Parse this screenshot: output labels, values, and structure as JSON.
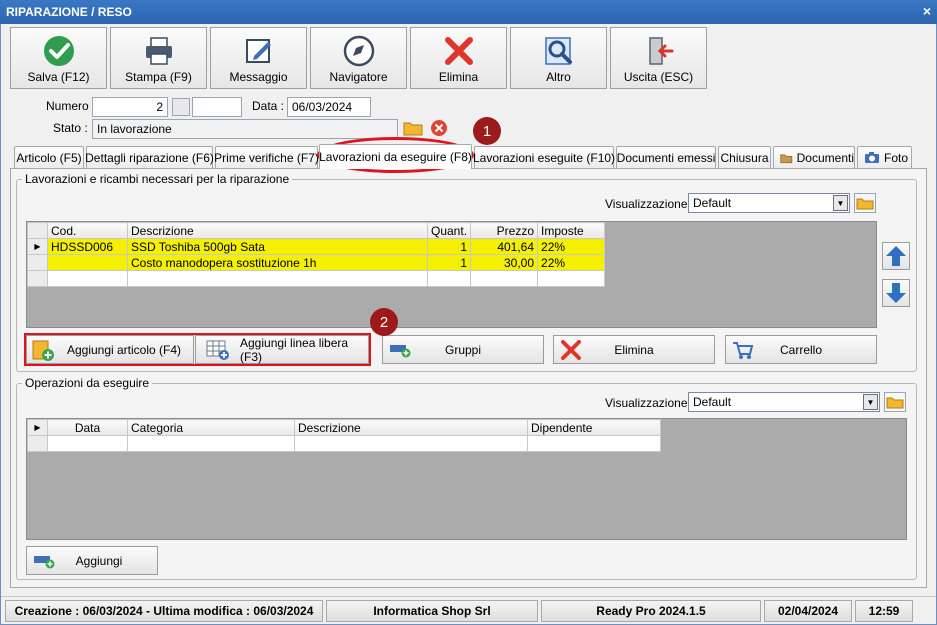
{
  "window": {
    "title": "RIPARAZIONE / RESO",
    "close_glyph": "×"
  },
  "toolbar": [
    {
      "label": "Salva (F12)",
      "icon": "check-circle-icon",
      "color": "#2e9d4e"
    },
    {
      "label": "Stampa (F9)",
      "icon": "printer-icon"
    },
    {
      "label": "Messaggio",
      "icon": "message-edit-icon"
    },
    {
      "label": "Navigatore",
      "icon": "compass-icon"
    },
    {
      "label": "Elimina",
      "icon": "delete-x-icon",
      "color": "#e0352b"
    },
    {
      "label": "Altro",
      "icon": "magnifier-icon"
    },
    {
      "label": "Uscita (ESC)",
      "icon": "exit-door-icon"
    }
  ],
  "form": {
    "numero_label": "Numero :",
    "numero_value": "2",
    "numero_suffix": "",
    "data_label": "Data :",
    "data_value": "06/03/2024",
    "stato_label": "Stato :",
    "stato_value": "In lavorazione"
  },
  "tabs": [
    {
      "label": "Articolo (F5)"
    },
    {
      "label": "Dettagli riparazione (F6)"
    },
    {
      "label": "Prime verifiche (F7)"
    },
    {
      "label": "Lavorazioni da eseguire (F8)",
      "active": true
    },
    {
      "label": "Lavorazioni eseguite (F10)"
    },
    {
      "label": "Documenti emessi"
    },
    {
      "label": "Chiusura"
    },
    {
      "label": "Documenti",
      "icon": "folder-icon"
    },
    {
      "label": "Foto",
      "icon": "camera-icon"
    }
  ],
  "lavorazioni": {
    "group_title": "Lavorazioni e ricambi necessari per la riparazione",
    "view_label": "Visualizzazione :",
    "view_value": "Default",
    "columns": [
      "Cod.",
      "Descrizione",
      "Quant.",
      "Prezzo",
      "Imposte"
    ],
    "rows": [
      {
        "cod": "HDSSD006",
        "descrizione": "SSD Toshiba 500gb Sata",
        "quant": "1",
        "prezzo": "401,64",
        "imposte": "22%"
      },
      {
        "cod": "",
        "descrizione": "Costo manodopera sostituzione 1h",
        "quant": "1",
        "prezzo": "30,00",
        "imposte": "22%"
      }
    ],
    "buttons": {
      "aggiungi_articolo": "Aggiungi articolo (F4)",
      "aggiungi_linea": "Aggiungi linea libera (F3)",
      "gruppi": "Gruppi",
      "elimina": "Elimina",
      "carrello": "Carrello"
    }
  },
  "operazioni": {
    "group_title": "Operazioni da eseguire",
    "view_label": "Visualizzazione :",
    "view_value": "Default",
    "columns": [
      "Data",
      "Categoria",
      "Descrizione",
      "Dipendente"
    ],
    "add_button": "Aggiungi"
  },
  "annotations": {
    "badge1": "1",
    "badge2": "2",
    "highlight_color": "#e0141e"
  },
  "statusbar": {
    "dates": "Creazione : 06/03/2024 - Ultima modifica : 06/03/2024",
    "company": "Informatica Shop Srl",
    "version": "Ready Pro 2024.1.5",
    "date": "02/04/2024",
    "time": "12:59"
  }
}
